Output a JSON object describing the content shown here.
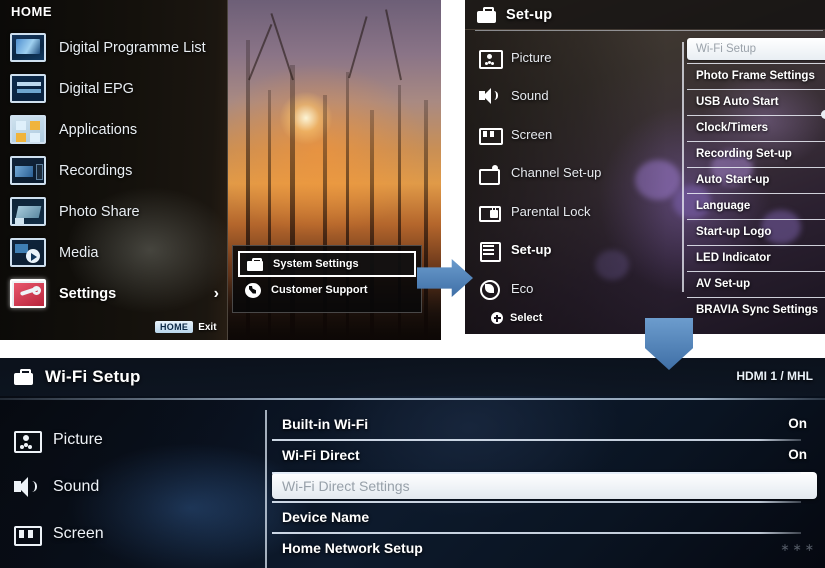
{
  "home_panel": {
    "title": "HOME",
    "items": [
      {
        "label": "Digital Programme List",
        "icon": "programme-list-thumbnail",
        "selected": false
      },
      {
        "label": "Digital EPG",
        "icon": "epg-thumbnail",
        "selected": false
      },
      {
        "label": "Applications",
        "icon": "applications-thumbnail",
        "selected": false
      },
      {
        "label": "Recordings",
        "icon": "recordings-thumbnail",
        "selected": false
      },
      {
        "label": "Photo Share",
        "icon": "photo-share-thumbnail",
        "selected": false
      },
      {
        "label": "Media",
        "icon": "media-thumbnail",
        "selected": false
      },
      {
        "label": "Settings",
        "icon": "settings-thumbnail",
        "selected": true
      }
    ],
    "chevron": "›",
    "footer": {
      "badge": "HOME",
      "label": "Exit"
    },
    "popup": {
      "items": [
        {
          "label": "System Settings",
          "icon": "toolbox-icon",
          "selected": true
        },
        {
          "label": "Customer Support",
          "icon": "phone-icon",
          "selected": false
        }
      ]
    }
  },
  "setup_panel": {
    "header": {
      "title": "Set-up",
      "icon": "toolbox-icon"
    },
    "nav": [
      {
        "label": "Picture",
        "icon": "picture-icon",
        "active": false
      },
      {
        "label": "Sound",
        "icon": "sound-icon",
        "active": false
      },
      {
        "label": "Screen",
        "icon": "screen-icon",
        "active": false
      },
      {
        "label": "Channel Set-up",
        "icon": "channel-icon",
        "active": false
      },
      {
        "label": "Parental Lock",
        "icon": "parental-lock-icon",
        "active": false
      },
      {
        "label": "Set-up",
        "icon": "setup-icon",
        "active": true
      },
      {
        "label": "Eco",
        "icon": "eco-icon",
        "active": false
      }
    ],
    "select_hint": {
      "label": "Select",
      "icon": "plus-circle-icon"
    },
    "items": [
      {
        "label": "Wi-Fi Setup",
        "highlight": true
      },
      {
        "label": "Photo Frame Settings",
        "highlight": false
      },
      {
        "label": "USB Auto Start",
        "highlight": false
      },
      {
        "label": "Clock/Timers",
        "highlight": false
      },
      {
        "label": "Recording Set-up",
        "highlight": false
      },
      {
        "label": "Auto Start-up",
        "highlight": false
      },
      {
        "label": "Language",
        "highlight": false
      },
      {
        "label": "Start-up Logo",
        "highlight": false
      },
      {
        "label": "LED Indicator",
        "highlight": false
      },
      {
        "label": "AV Set-up",
        "highlight": false
      },
      {
        "label": "BRAVIA Sync Settings",
        "highlight": false
      }
    ]
  },
  "wifi_panel": {
    "header": {
      "title": "Wi-Fi Setup",
      "icon": "toolbox-icon",
      "source": "HDMI 1 / MHL"
    },
    "nav": [
      {
        "label": "Picture",
        "icon": "picture-icon"
      },
      {
        "label": "Sound",
        "icon": "sound-icon"
      },
      {
        "label": "Screen",
        "icon": "screen-icon"
      }
    ],
    "items": [
      {
        "label": "Built-in Wi-Fi",
        "value": "On",
        "highlight": false
      },
      {
        "label": "Wi-Fi Direct",
        "value": "On",
        "highlight": false
      },
      {
        "label": "Wi-Fi Direct Settings",
        "value": "",
        "highlight": true
      },
      {
        "label": "Device Name",
        "value": "",
        "highlight": false
      },
      {
        "label": "Home Network Setup",
        "value": "",
        "highlight": false
      }
    ],
    "watermark": "∗∗∗"
  },
  "arrows": {
    "right": "arrow-right-icon",
    "down": "arrow-down-icon",
    "color": "#4f7fb4"
  },
  "colors": {
    "highlight_fill": "#ffffff",
    "highlight_text": "#97a0a9",
    "accent_blue": "#4f7fb4",
    "text_primary": "#ffffff"
  }
}
